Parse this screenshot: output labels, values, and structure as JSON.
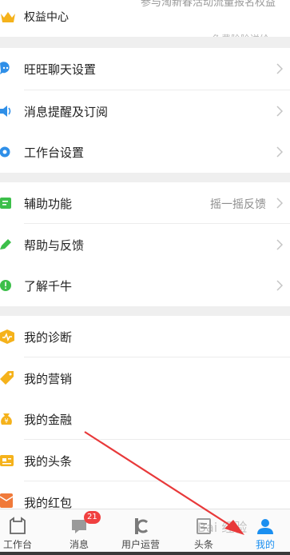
{
  "header_item": {
    "label": "权益中心",
    "promo_text": "参与淘新春活动流量报名权益",
    "promo_sub": "免费险险送给"
  },
  "sections": [
    {
      "items": [
        {
          "label": "旺旺聊天设置",
          "icon": "chat-bubble-icon",
          "color": "#2f8fe8"
        },
        {
          "label": "消息提醒及订阅",
          "icon": "speaker-icon",
          "color": "#2f8fe8"
        },
        {
          "label": "工作台设置",
          "icon": "gear-icon",
          "color": "#2f8fe8"
        }
      ]
    },
    {
      "items": [
        {
          "label": "辅助功能",
          "value": "摇一摇反馈",
          "icon": "assist-icon",
          "color": "#3cbf4a"
        },
        {
          "label": "帮助与反馈",
          "icon": "pencil-icon",
          "color": "#3cbf4a"
        },
        {
          "label": "了解千牛",
          "icon": "info-icon",
          "color": "#3cbf4a"
        }
      ]
    },
    {
      "items": [
        {
          "label": "我的诊断",
          "icon": "diagnosis-icon",
          "color": "#f5b21b"
        },
        {
          "label": "我的营销",
          "icon": "tag-icon",
          "color": "#f5b21b"
        },
        {
          "label": "我的金融",
          "icon": "money-bag-icon",
          "color": "#f5b21b"
        },
        {
          "label": "我的头条",
          "icon": "headline-icon",
          "color": "#f5b21b"
        },
        {
          "label": "我的红包",
          "icon": "red-packet-icon",
          "color": "#f07a3a"
        }
      ]
    }
  ],
  "tabbar": {
    "tabs": [
      {
        "label": "工作台",
        "icon": "workbench-icon"
      },
      {
        "label": "消息",
        "icon": "message-icon",
        "badge": "21"
      },
      {
        "label": "用户运营",
        "icon": "user-ops-icon"
      },
      {
        "label": "头条",
        "icon": "headline-tab-icon"
      },
      {
        "label": "我的",
        "icon": "profile-icon",
        "active": true
      }
    ]
  },
  "colors": {
    "accent": "#1a8ff0",
    "badge": "#f04040",
    "annotation_arrow": "#e8393a"
  },
  "watermark": "Bai 经验"
}
